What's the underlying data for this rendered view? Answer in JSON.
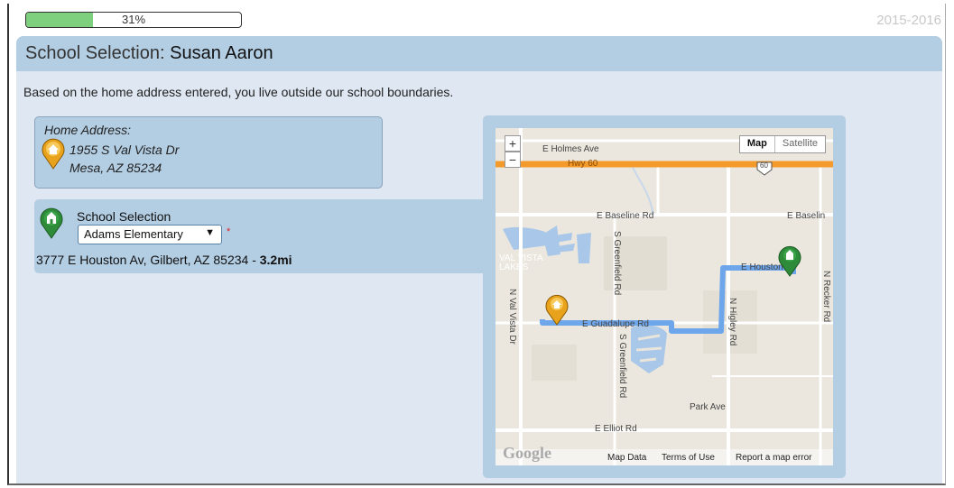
{
  "progress": {
    "value": 0.31,
    "label": "31%"
  },
  "school_year": "2015-2016",
  "header": {
    "title_prefix": "School Selection:",
    "student_name": "Susan Aaron"
  },
  "intro_text": "Based on the home address entered, you live outside our school boundaries.",
  "home": {
    "label": "Home Address:",
    "line1": "1955 S Val Vista Dr",
    "line2": "Mesa, AZ 85234",
    "icon": "home-pin-icon"
  },
  "school": {
    "label": "School Selection",
    "selected": "Adams Elementary",
    "required_mark": "*",
    "address": "3777 E Houston Av, Gilbert, AZ 85234 -",
    "distance": "3.2mi",
    "icon": "school-pin-icon"
  },
  "map": {
    "zoom_in": "+",
    "zoom_out": "−",
    "type_map": "Map",
    "type_satellite": "Satellite",
    "labels": {
      "holmes": "E Holmes Ave",
      "hwy": "Hwy 60",
      "shield": "60",
      "baseline": "E Baseline Rd",
      "baseline2": "E Baselin",
      "valvista_lakes": "VAL VISTA LAKES",
      "houston": "E Houston",
      "guadalupe": "E Guadalupe Rd",
      "greenfield1": "S Greenfield Rd",
      "greenfield2": "S Greenfield Rd",
      "valvista": "N Val Vista Dr",
      "higley": "N Higley Rd",
      "recker": "N Recker Rd",
      "park": "Park Ave",
      "elliot": "E Elliot Rd"
    },
    "footer": {
      "logo": "Google",
      "map_data": "Map Data",
      "terms": "Terms of Use",
      "report": "Report a map error"
    },
    "colors": {
      "route": "#6ea6ec",
      "highway": "#f39a2a",
      "home_pin": "#e8a21c",
      "school_pin": "#2e8b3a"
    }
  }
}
